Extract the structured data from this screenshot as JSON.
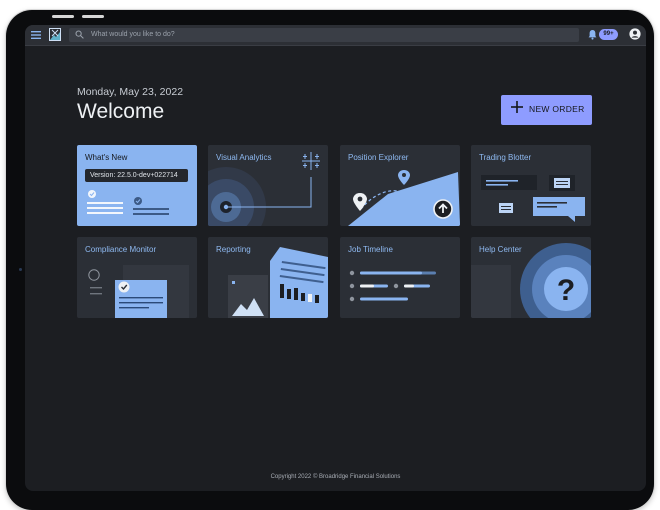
{
  "search": {
    "placeholder": "What would you like to do?"
  },
  "notifications": {
    "badge": "99+"
  },
  "header": {
    "date": "Monday, May 23, 2022",
    "welcome": "Welcome"
  },
  "actions": {
    "new_order": "NEW ORDER"
  },
  "tiles": [
    {
      "title": "What's New",
      "version": "Version: 22.5.0-dev+022714"
    },
    {
      "title": "Visual Analytics"
    },
    {
      "title": "Position Explorer"
    },
    {
      "title": "Trading Blotter"
    },
    {
      "title": "Compliance Monitor"
    },
    {
      "title": "Reporting"
    },
    {
      "title": "Job Timeline"
    },
    {
      "title": "Help Center"
    }
  ],
  "footer": {
    "copyright": "Copyright 2022 © Broadridge Financial Solutions"
  },
  "colors": {
    "accent": "#8e9cff",
    "tile_blue": "#8ab4f0",
    "background": "#1c1e22"
  }
}
